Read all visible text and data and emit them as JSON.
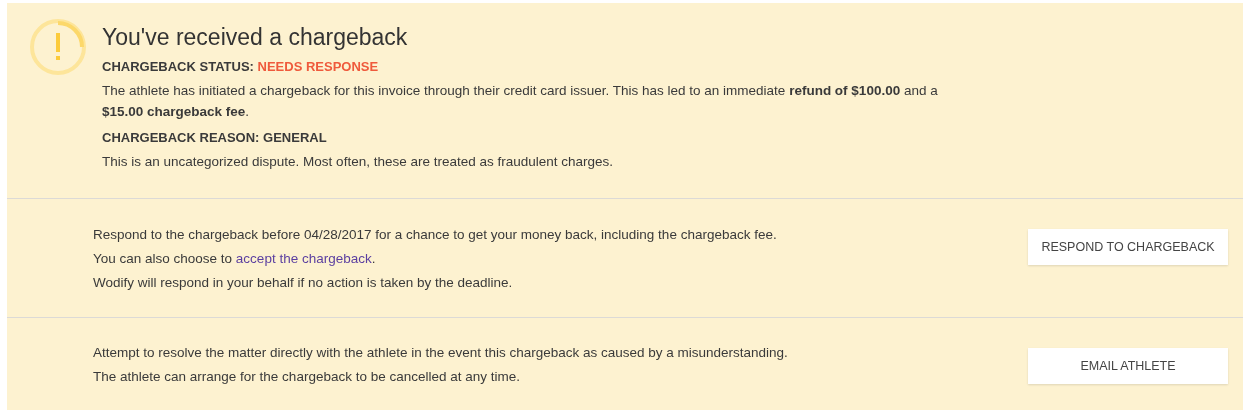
{
  "alert": {
    "title": "You've received a chargeback",
    "status": {
      "label": "CHARGEBACK STATUS:",
      "value": "NEEDS RESPONSE",
      "color": "#ef5a3c"
    },
    "description": "The athlete has initiated a chargeback for this invoice through their credit card issuer. This has led to an immediate **refund of $100.00** and a **$15.00 chargeback fee**.",
    "reason": "CHARGEBACK REASON: GENERAL",
    "reason_note": "This is an uncategorized dispute. Most often, these are treated as fraudulent charges."
  },
  "actions": [
    {
      "lines": [
        {
          "text": "Respond to the chargeback before 04/28/2017 for a chance to get your money back, including the chargeback fee."
        },
        {
          "text": "You can also choose to ",
          "link": "accept the chargeback",
          "after": "."
        },
        {
          "text": "Wodify will respond in your behalf if no action is taken by the deadline."
        }
      ],
      "button": "RESPOND TO CHARGEBACK"
    },
    {
      "lines": [
        {
          "text": "Attempt to resolve the matter directly with the athlete in the event this chargeback as caused by a misunderstanding."
        },
        {
          "text": "The athlete can arrange for the chargeback to be cancelled at any time."
        }
      ],
      "button": "EMAIL ATHLETE"
    }
  ]
}
